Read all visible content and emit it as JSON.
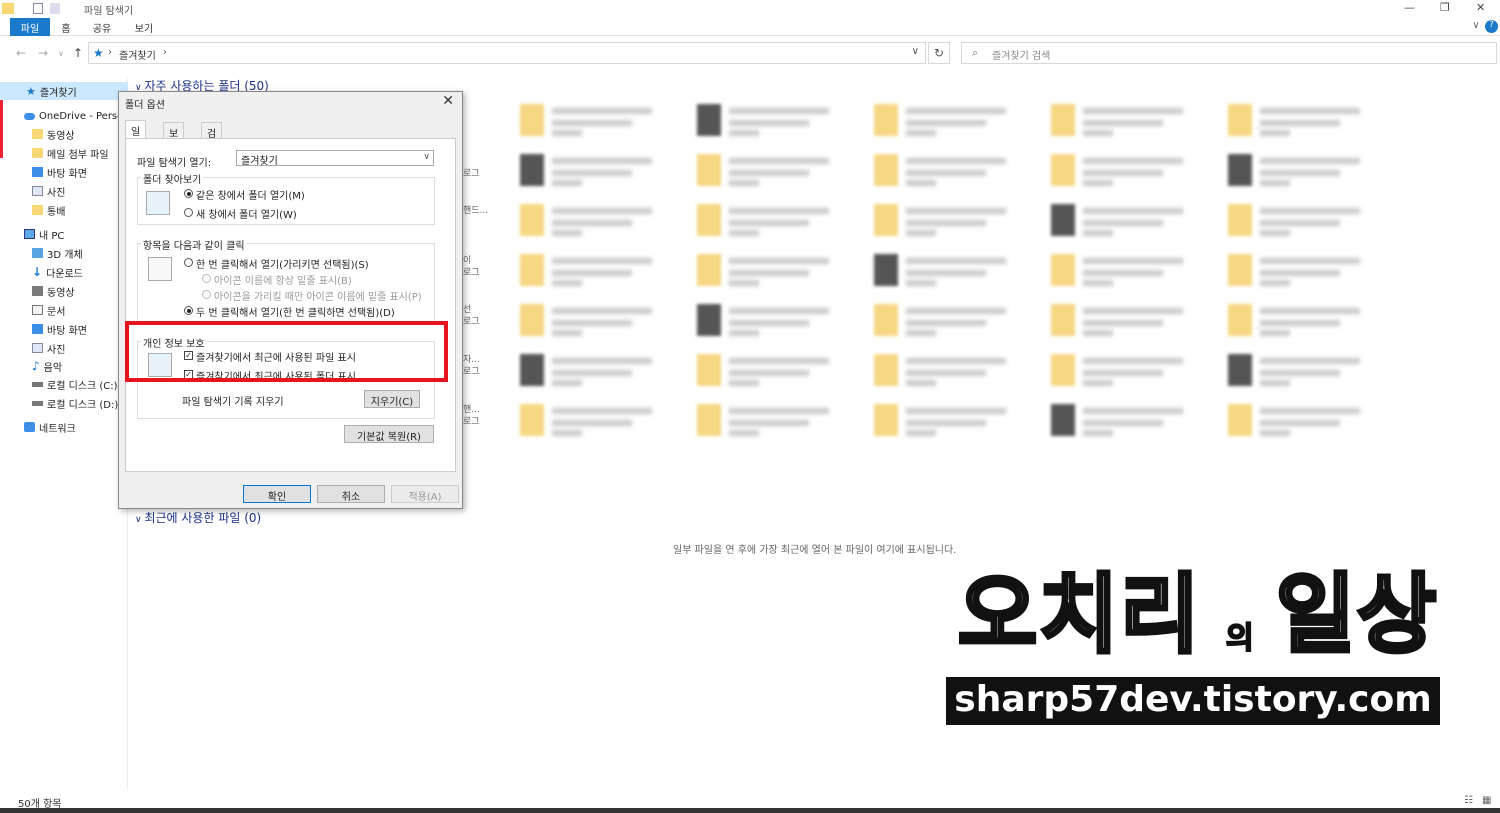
{
  "window": {
    "title": "파일 탐색기",
    "min": "—",
    "restore": "❐",
    "close": "✕",
    "collapse": "∨",
    "help": "?"
  },
  "ribbon": {
    "tabs": [
      "파일",
      "홈",
      "공유",
      "보기"
    ]
  },
  "address": {
    "path": "즐겨찾기",
    "sep": "›",
    "search_placeholder": "즐겨찾기 검색"
  },
  "sidebar": {
    "items": [
      {
        "label": "즐겨찾기",
        "icon": "star-icon"
      },
      {
        "label": "OneDrive - Person",
        "icon": "cloud-icon"
      },
      {
        "label": "동영상",
        "icon": "folder-icon"
      },
      {
        "label": "메일 첨부 파일",
        "icon": "folder-icon"
      },
      {
        "label": "바탕 화면",
        "icon": "desktop-icon"
      },
      {
        "label": "사진",
        "icon": "picture-icon"
      },
      {
        "label": "통배",
        "icon": "folder-icon"
      },
      {
        "label": "내 PC",
        "icon": "pc-icon"
      },
      {
        "label": "3D 개체",
        "icon": "cube-icon"
      },
      {
        "label": "다운로드",
        "icon": "download-icon"
      },
      {
        "label": "동영상",
        "icon": "video-icon"
      },
      {
        "label": "문서",
        "icon": "document-icon"
      },
      {
        "label": "바탕 화면",
        "icon": "desktop-icon"
      },
      {
        "label": "사진",
        "icon": "picture-icon"
      },
      {
        "label": "음악",
        "icon": "music-icon"
      },
      {
        "label": "로컬 디스크 (C:)",
        "icon": "drive-icon"
      },
      {
        "label": "로컬 디스크 (D:)",
        "icon": "drive-icon"
      },
      {
        "label": "네트워크",
        "icon": "network-icon"
      }
    ]
  },
  "content": {
    "frequent_header": "자주 사용하는 폴더 (50)",
    "recent_header": "최근에 사용한 파일 (0)",
    "recent_empty": "일부 파일을 연 후에 가장 최근에 열어 본 파일이 여기에 표시됩니다.",
    "partial_labels": [
      "로그",
      "핸드...",
      "이",
      "로그",
      "선",
      "로그",
      "자...",
      "로그",
      "핸...",
      "로그"
    ]
  },
  "dialog": {
    "title": "폴더 옵션",
    "close": "✕",
    "tabs": [
      "일반",
      "보기",
      "검색"
    ],
    "open_explorer_label": "파일 탐색기 열기:",
    "open_explorer_value": "즐겨찾기",
    "browse_group": "폴더 찾아보기",
    "browse_same": "같은 창에서 폴더 열기(M)",
    "browse_new": "새 창에서 폴더 열기(W)",
    "click_group": "항목을 다음과 같이 클릭",
    "single_click": "한 번 클릭해서 열기(가리키면 선택됨)(S)",
    "underline_always": "아이콘 이름에 항상 밑줄 표시(B)",
    "underline_hover": "아이콘을 가리킬 때만 아이콘 이름에 밑줄 표시(P)",
    "double_click": "두 번 클릭해서 열기(한 번 클릭하면 선택됨)(D)",
    "privacy_group": "개인 정보 보호",
    "show_recent_files": "즐겨찾기에서 최근에 사용된 파일 표시",
    "show_recent_folders": "즐겨찾기에서 최근에 사용된 폴더 표시",
    "clear_history_label": "파일 탐색기 기록 지우기",
    "clear_button": "지우기(C)",
    "restore_defaults": "기본값 복원(R)",
    "ok": "확인",
    "cancel": "취소",
    "apply": "적용(A)"
  },
  "watermark": {
    "big": "오치리",
    "small": "의",
    "big2": "일상",
    "url": "sharp57dev.tistory.com"
  },
  "status": {
    "count": "50개 항목"
  }
}
